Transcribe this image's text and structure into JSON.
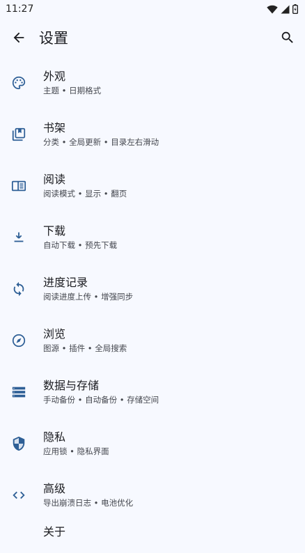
{
  "status_bar": {
    "time": "11:27"
  },
  "app_bar": {
    "title": "设置"
  },
  "items": [
    {
      "title": "外观",
      "subtitle": "主题 • 日期格式",
      "icon": "palette-icon"
    },
    {
      "title": "书架",
      "subtitle": "分类 • 全局更新 • 目录左右滑动",
      "icon": "library-icon"
    },
    {
      "title": "阅读",
      "subtitle": "阅读模式 • 显示 • 翻页",
      "icon": "reader-icon"
    },
    {
      "title": "下载",
      "subtitle": "自动下载 • 预先下载",
      "icon": "download-icon"
    },
    {
      "title": "进度记录",
      "subtitle": "阅读进度上传 • 增强同步",
      "icon": "sync-icon"
    },
    {
      "title": "浏览",
      "subtitle": "图源 • 插件 • 全局搜索",
      "icon": "compass-icon"
    },
    {
      "title": "数据与存储",
      "subtitle": "手动备份 • 自动备份 • 存储空间",
      "icon": "storage-icon"
    },
    {
      "title": "隐私",
      "subtitle": "应用锁 • 隐私界面",
      "icon": "shield-icon"
    },
    {
      "title": "高级",
      "subtitle": "导出崩溃日志 • 电池优化",
      "icon": "code-icon"
    },
    {
      "title": "关于",
      "subtitle": "",
      "icon": "info-icon"
    }
  ],
  "colors": {
    "background": "#f7f9ff",
    "icon": "#2e5f96"
  }
}
